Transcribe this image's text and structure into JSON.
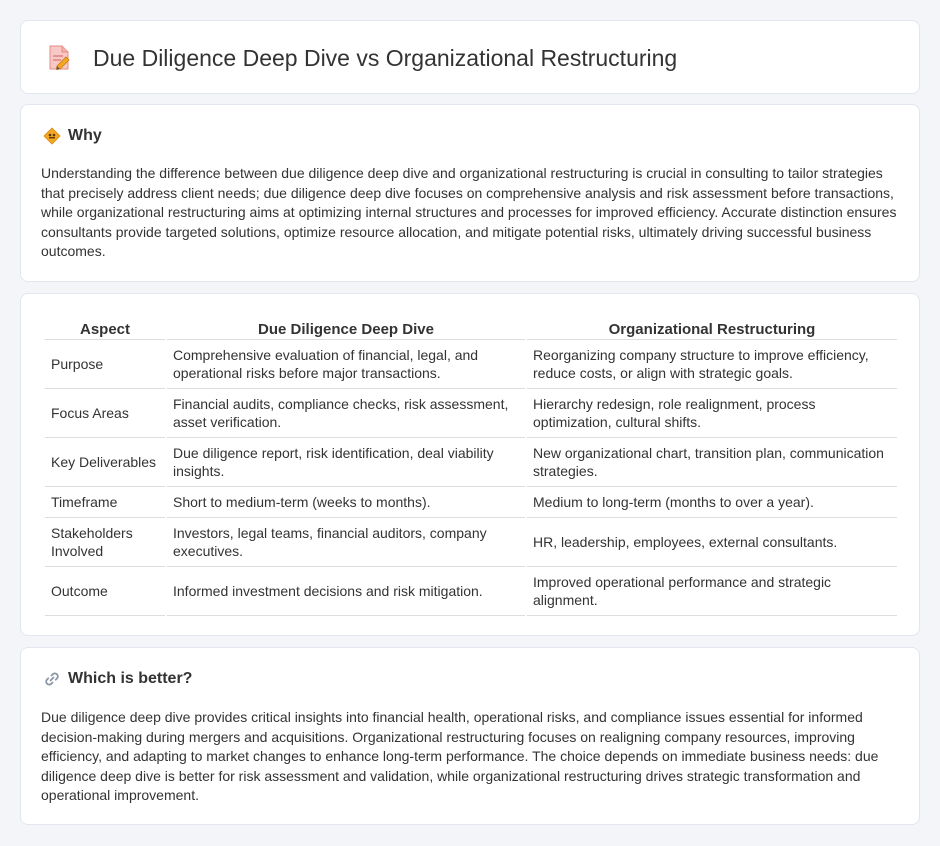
{
  "header": {
    "title": "Due Diligence Deep Dive vs Organizational Restructuring",
    "icon": "document-edit-icon"
  },
  "why": {
    "title": "Why",
    "icon": "diamond-sign-icon",
    "body": "Understanding the difference between due diligence deep dive and organizational restructuring is crucial in consulting to tailor strategies that precisely address client needs; due diligence deep dive focuses on comprehensive analysis and risk assessment before transactions, while organizational restructuring aims at optimizing internal structures and processes for improved efficiency. Accurate distinction ensures consultants provide targeted solutions, optimize resource allocation, and mitigate potential risks, ultimately driving successful business outcomes."
  },
  "table": {
    "headers": [
      "Aspect",
      "Due Diligence Deep Dive",
      "Organizational Restructuring"
    ],
    "rows": [
      [
        "Purpose",
        "Comprehensive evaluation of financial, legal, and operational risks before major transactions.",
        "Reorganizing company structure to improve efficiency, reduce costs, or align with strategic goals."
      ],
      [
        "Focus Areas",
        "Financial audits, compliance checks, risk assessment, asset verification.",
        "Hierarchy redesign, role realignment, process optimization, cultural shifts."
      ],
      [
        "Key Deliverables",
        "Due diligence report, risk identification, deal viability insights.",
        "New organizational chart, transition plan, communication strategies."
      ],
      [
        "Timeframe",
        "Short to medium-term (weeks to months).",
        "Medium to long-term (months to over a year)."
      ],
      [
        "Stakeholders Involved",
        "Investors, legal teams, financial auditors, company executives.",
        "HR, leadership, employees, external consultants."
      ],
      [
        "Outcome",
        "Informed investment decisions and risk mitigation.",
        "Improved operational performance and strategic alignment."
      ]
    ]
  },
  "better": {
    "title": "Which is better?",
    "icon": "link-icon",
    "body": "Due diligence deep dive provides critical insights into financial health, operational risks, and compliance issues essential for informed decision-making during mergers and acquisitions. Organizational restructuring focuses on realigning company resources, improving efficiency, and adapting to market changes to enhance long-term performance. The choice depends on immediate business needs: due diligence deep dive is better for risk assessment and validation, while organizational restructuring drives strategic transformation and operational improvement."
  }
}
